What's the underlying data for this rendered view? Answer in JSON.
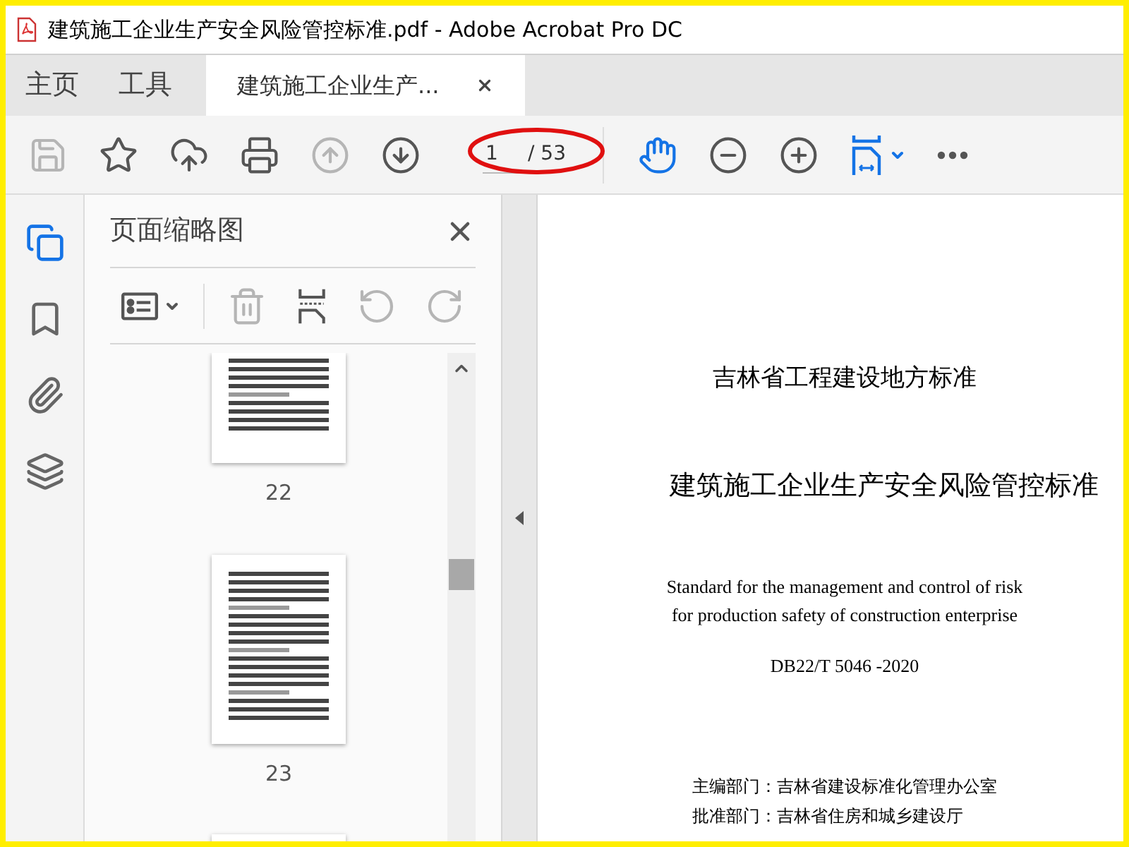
{
  "window": {
    "title": "建筑施工企业生产安全风险管控标准.pdf - Adobe Acrobat Pro DC"
  },
  "tabs": [
    {
      "kind": "nav",
      "label": "主页",
      "selected": false
    },
    {
      "kind": "nav",
      "label": "工具",
      "selected": false
    },
    {
      "kind": "document",
      "label": "建筑施工企业生产...",
      "selected": true
    }
  ],
  "toolbar": {
    "left": [
      {
        "kind": "save",
        "disabled": true
      },
      {
        "kind": "star",
        "disabled": false
      },
      {
        "kind": "upload",
        "disabled": false
      },
      {
        "kind": "print",
        "disabled": false
      },
      {
        "kind": "prev",
        "disabled": true
      },
      {
        "kind": "next",
        "disabled": false
      }
    ],
    "page": {
      "value": "1",
      "total": "/ 53"
    },
    "right": [
      {
        "kind": "hand",
        "disabled": false
      },
      {
        "kind": "zoomout",
        "disabled": false
      },
      {
        "kind": "zoomin",
        "disabled": false
      },
      {
        "kind": "fit",
        "disabled": false
      },
      {
        "kind": "more",
        "disabled": false
      }
    ]
  },
  "nav_rail": [
    {
      "kind": "pages",
      "selected": true
    },
    {
      "kind": "bookmarks",
      "selected": false
    },
    {
      "kind": "attachments",
      "selected": false
    },
    {
      "kind": "layers",
      "selected": false
    }
  ],
  "thumbnail_panel": {
    "title": "页面缩略图",
    "tools": [
      {
        "kind": "options",
        "disabled": false
      },
      {
        "kind": "delete",
        "disabled": true
      },
      {
        "kind": "insert",
        "disabled": false
      },
      {
        "kind": "undo",
        "disabled": true
      },
      {
        "kind": "redo",
        "disabled": true
      }
    ],
    "pages": [
      {
        "kind": "top_cut",
        "label": "22"
      },
      {
        "kind": "full",
        "label": "23"
      },
      {
        "kind": "bottom_cut"
      }
    ]
  },
  "document": {
    "heading": "吉林省工程建设地方标准",
    "title": "建筑施工企业生产安全风险管控标准",
    "english_title": [
      "Standard for the management and control of risk",
      "for production safety of construction enterprise"
    ],
    "code": "DB22/T 5046 -2020",
    "credits": [
      "主编部门：吉林省建设标准化管理办公室",
      "批准部门：吉林省住房和城乡建设厅"
    ]
  }
}
